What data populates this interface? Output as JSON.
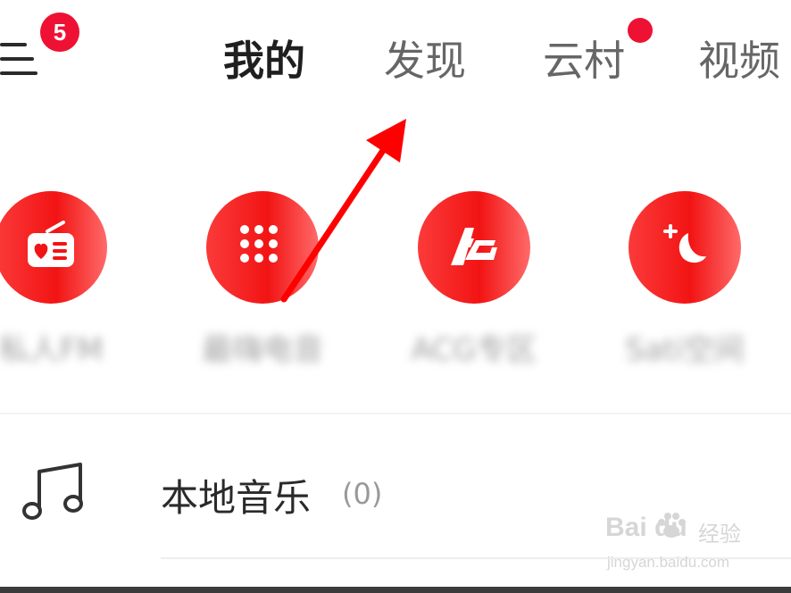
{
  "header": {
    "notification_count": "5",
    "tabs": [
      {
        "label": "我的",
        "active": true
      },
      {
        "label": "发现",
        "active": false
      },
      {
        "label": "云村",
        "active": false,
        "has_dot": true
      },
      {
        "label": "视频",
        "active": false
      }
    ]
  },
  "features": [
    {
      "label": "私人FM",
      "icon": "radio-icon"
    },
    {
      "label": "最嗨电音",
      "icon": "grid-dots-icon"
    },
    {
      "label": "ACG专区",
      "icon": "acg-icon"
    },
    {
      "label": "Sati空间",
      "icon": "moon-star-icon"
    }
  ],
  "list": {
    "local_music": {
      "label": "本地音乐",
      "count": "(0)",
      "icon": "music-note-icon"
    }
  },
  "watermark": {
    "logo": "Bai du",
    "name": "经验",
    "url": "jingyan.baidu.com"
  },
  "colors": {
    "accent": "#ee1133",
    "icon_red": "#f21414",
    "annotation_arrow": "#ff0000"
  }
}
